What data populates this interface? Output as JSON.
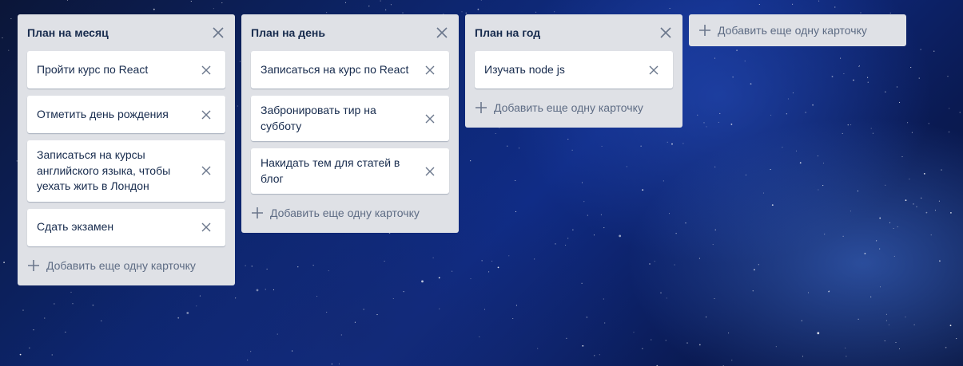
{
  "background": {
    "theme": "starry night sky",
    "colors": [
      "#0b1638",
      "#0d2670",
      "#102c86",
      "#08143e"
    ]
  },
  "columns": [
    {
      "title": "План на месяц",
      "cards": [
        "Пройти курс по React",
        "Отметить день рождения",
        "Записаться на курсы английского языка, чтобы уехать жить в Лондон",
        "Сдать экзамен"
      ],
      "add_label": "Добавить еще одну карточку"
    },
    {
      "title": "План на день",
      "cards": [
        "Записаться на курс по React",
        "Забронировать тир на субботу",
        "Накидать тем для статей в блог"
      ],
      "add_label": "Добавить еще одну карточку"
    },
    {
      "title": "План на год",
      "cards": [
        "Изучать node js"
      ],
      "add_label": "Добавить еще одну карточку"
    }
  ],
  "add_list": {
    "label": "Добавить еще одну карточку"
  },
  "icons": {
    "close": "close-icon",
    "plus": "plus-icon"
  },
  "colors": {
    "column_bg": "#dfe1e6",
    "card_bg": "#ffffff",
    "title_text": "#172b4d",
    "muted_text": "#5e6c84"
  }
}
